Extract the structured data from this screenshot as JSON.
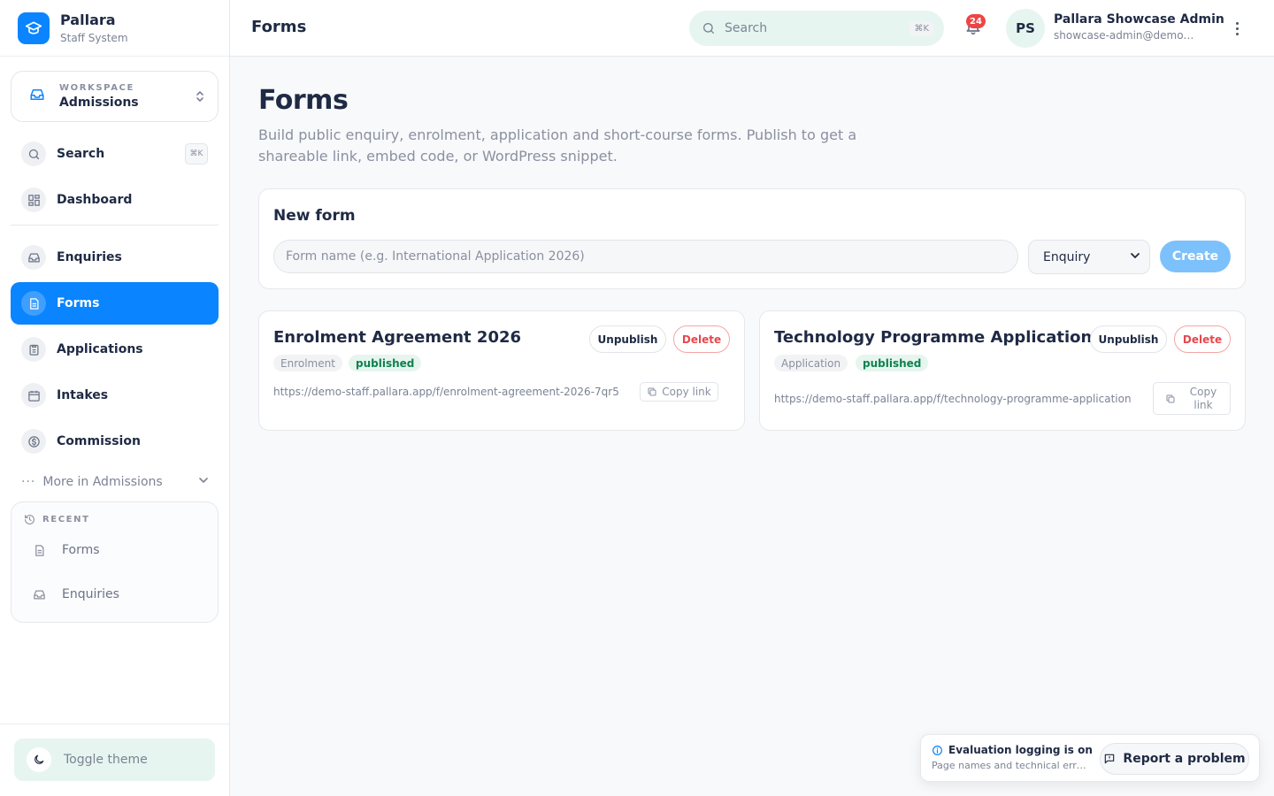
{
  "brand": {
    "name": "Pallara",
    "subtitle": "Staff System"
  },
  "workspace": {
    "label": "WORKSPACE",
    "name": "Admissions"
  },
  "sidebar": {
    "search": {
      "label": "Search",
      "shortcut": "⌘K"
    },
    "items": [
      {
        "label": "Dashboard",
        "icon": "grid-icon"
      },
      {
        "label": "Enquiries",
        "icon": "inbox-icon"
      },
      {
        "label": "Forms",
        "icon": "document-icon",
        "active": true
      },
      {
        "label": "Applications",
        "icon": "clipboard-icon"
      },
      {
        "label": "Intakes",
        "icon": "calendar-icon"
      },
      {
        "label": "Commission",
        "icon": "dollar-icon"
      }
    ],
    "more_label": "More in Admissions",
    "recent": {
      "heading": "RECENT",
      "items": [
        {
          "label": "Forms",
          "icon": "document-icon"
        },
        {
          "label": "Enquiries",
          "icon": "inbox-icon"
        }
      ]
    },
    "theme_toggle": "Toggle theme"
  },
  "header": {
    "title": "Forms",
    "search": {
      "placeholder": "Search",
      "shortcut": "⌘K"
    },
    "notifications_count": "24",
    "user": {
      "initials": "PS",
      "name": "Pallara Showcase Admin",
      "email": "showcase-admin@demo.pallara.app"
    }
  },
  "page": {
    "title": "Forms",
    "description": "Build public enquiry, enrolment, application and short-course forms. Publish to get a shareable link, embed code, or WordPress snippet."
  },
  "new_form": {
    "title": "New form",
    "name_placeholder": "Form name (e.g. International Application 2026)",
    "type_selected": "Enquiry",
    "create_label": "Create"
  },
  "forms": [
    {
      "title": "Enrolment Agreement 2026",
      "type": "Enrolment",
      "status": "published",
      "url": "https://demo-staff.pallara.app/f/enrolment-agreement-2026-7qr5",
      "unpublish_label": "Unpublish",
      "delete_label": "Delete",
      "copy_label": "Copy link"
    },
    {
      "title": "Technology Programme Application",
      "type": "Application",
      "status": "published",
      "url": "https://demo-staff.pallara.app/f/technology-programme-application",
      "unpublish_label": "Unpublish",
      "delete_label": "Delete",
      "copy_label": "Copy link"
    }
  ],
  "toast": {
    "title": "Evaluation logging is on",
    "subtitle": "Page names and technical errors are logged",
    "report_label": "Report a problem"
  },
  "colors": {
    "accent": "#0a84ff",
    "mint": "#e7f5f0",
    "danger": "#e5484d",
    "success": "#10804f"
  }
}
